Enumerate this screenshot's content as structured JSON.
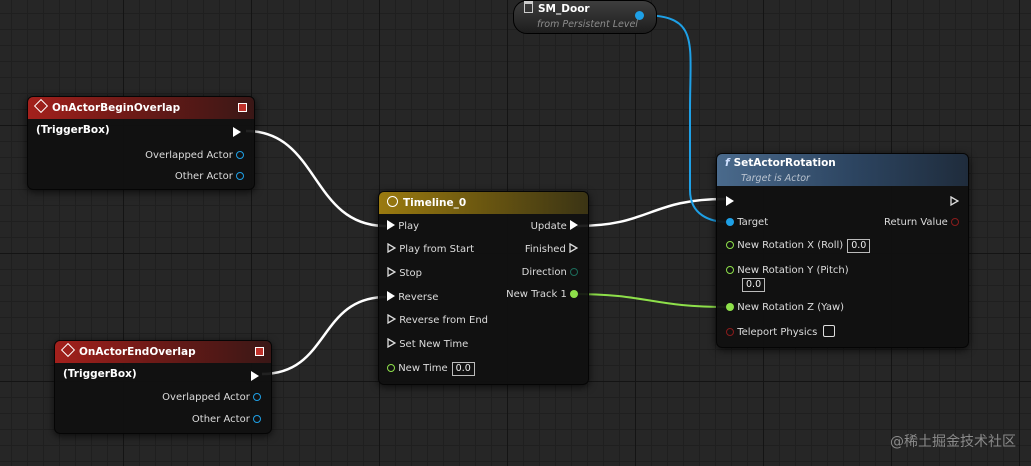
{
  "nodes": {
    "sm_door": {
      "title": "SM_Door",
      "subtitle": "from Persistent Level"
    },
    "begin_overlap": {
      "title": "OnActorBeginOverlap (TriggerBox)",
      "pins": [
        "Overlapped Actor",
        "Other Actor"
      ]
    },
    "end_overlap": {
      "title": "OnActorEndOverlap (TriggerBox)",
      "pins": [
        "Overlapped Actor",
        "Other Actor"
      ]
    },
    "timeline": {
      "title": "Timeline_0",
      "inputs": [
        "Play",
        "Play from Start",
        "Stop",
        "Reverse",
        "Reverse from End",
        "Set New Time",
        "New Time"
      ],
      "outputs": [
        "Update",
        "Finished",
        "Direction",
        "New Track 1"
      ],
      "new_time_value": "0.0"
    },
    "set_rotation": {
      "title": "SetActorRotation",
      "subtitle": "Target is Actor",
      "target_label": "Target",
      "return_label": "Return Value",
      "rot_x_label": "New Rotation X (Roll)",
      "rot_x_value": "0.0",
      "rot_y_label": "New Rotation Y (Pitch)",
      "rot_y_value": "0.0",
      "rot_z_label": "New Rotation Z (Yaw)",
      "teleport_label": "Teleport Physics"
    }
  },
  "colors": {
    "exec_wire": "#ffffff",
    "object_pin": "#1ea0e6",
    "float_pin": "#8ee04a",
    "bool_pin": "#8a1c1c",
    "event_header": "#a3201c",
    "timeline_header": "#9a7a10",
    "function_header": "#4a6a8c"
  },
  "watermark": "@稀土掘金技术社区"
}
